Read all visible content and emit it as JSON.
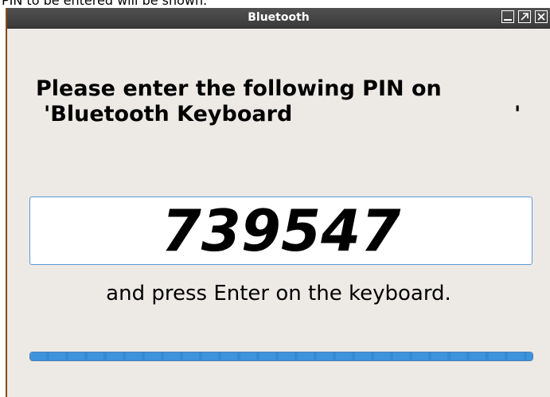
{
  "background_caption": "PIN to be entered will be shown.",
  "window": {
    "title": "Bluetooth",
    "buttons": [
      "minimize-icon",
      "maximize-icon",
      "close-icon"
    ]
  },
  "dialog": {
    "heading_line1": "Please enter the following PIN on",
    "heading_line2": "'Bluetooth Keyboard",
    "heading_closing_quote": "'",
    "pin": "739547",
    "instruction": "and press Enter on the keyboard.",
    "progress_percent": 100
  },
  "colors": {
    "titlebar": "#444444",
    "window_bg": "#edeae6",
    "border_accent": "#8a4a12",
    "progress": "#3d93dc",
    "pin_border": "#5c9ad6"
  }
}
